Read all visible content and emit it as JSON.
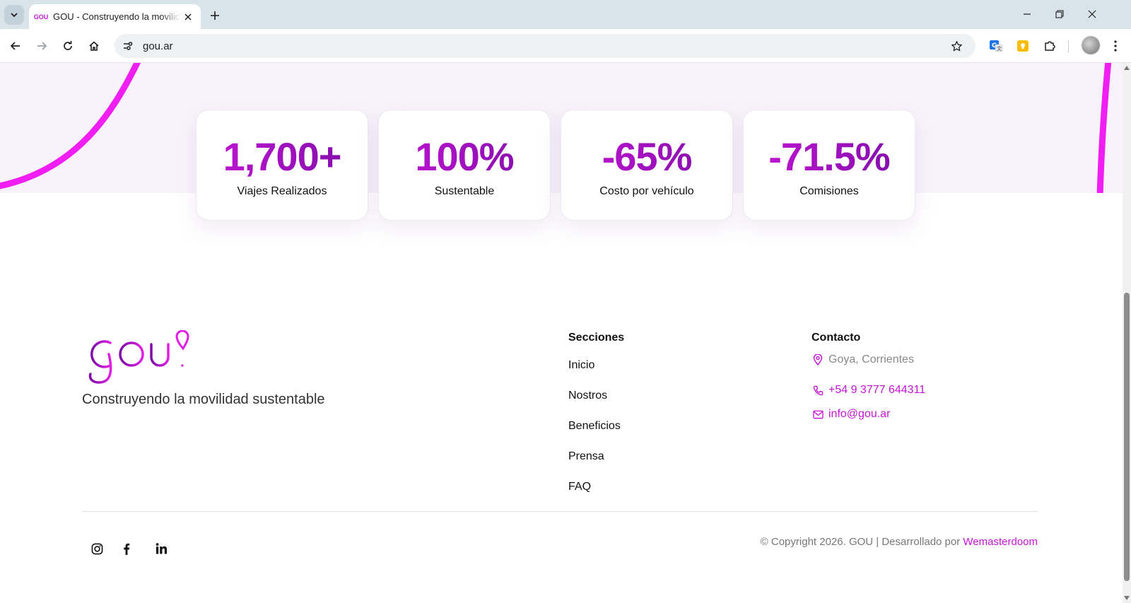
{
  "browser": {
    "tab_title": "GOU - Construyendo la movilidad sustentable",
    "favicon_text": "GOU",
    "url": "gou.ar"
  },
  "stats": [
    {
      "value": "1,700+",
      "label": "Viajes Realizados"
    },
    {
      "value": "100%",
      "label": "Sustentable"
    },
    {
      "value": "-65%",
      "label": "Costo por vehículo"
    },
    {
      "value": "-71.5%",
      "label": "Comisiones"
    }
  ],
  "footer": {
    "tagline": "Construyendo la movilidad sustentable",
    "sections": {
      "title": "Secciones",
      "links": [
        "Inicio",
        "Nostros",
        "Beneficios",
        "Prensa",
        "FAQ"
      ]
    },
    "contact": {
      "title": "Contacto",
      "location": "Goya, Corrientes",
      "phone": "+54 9 3777 644311",
      "email": "info@gou.ar"
    },
    "copyright": "© Copyright 2026. GOU | Desarrollado por",
    "credit": "Wemasterdoom",
    "social": [
      "instagram-icon",
      "facebook-icon",
      "linkedin-icon"
    ]
  },
  "colors": {
    "brand_magenta": "#c514d6",
    "brand_purple": "#7d0ea7",
    "hero_band": "#f8f3fb"
  }
}
